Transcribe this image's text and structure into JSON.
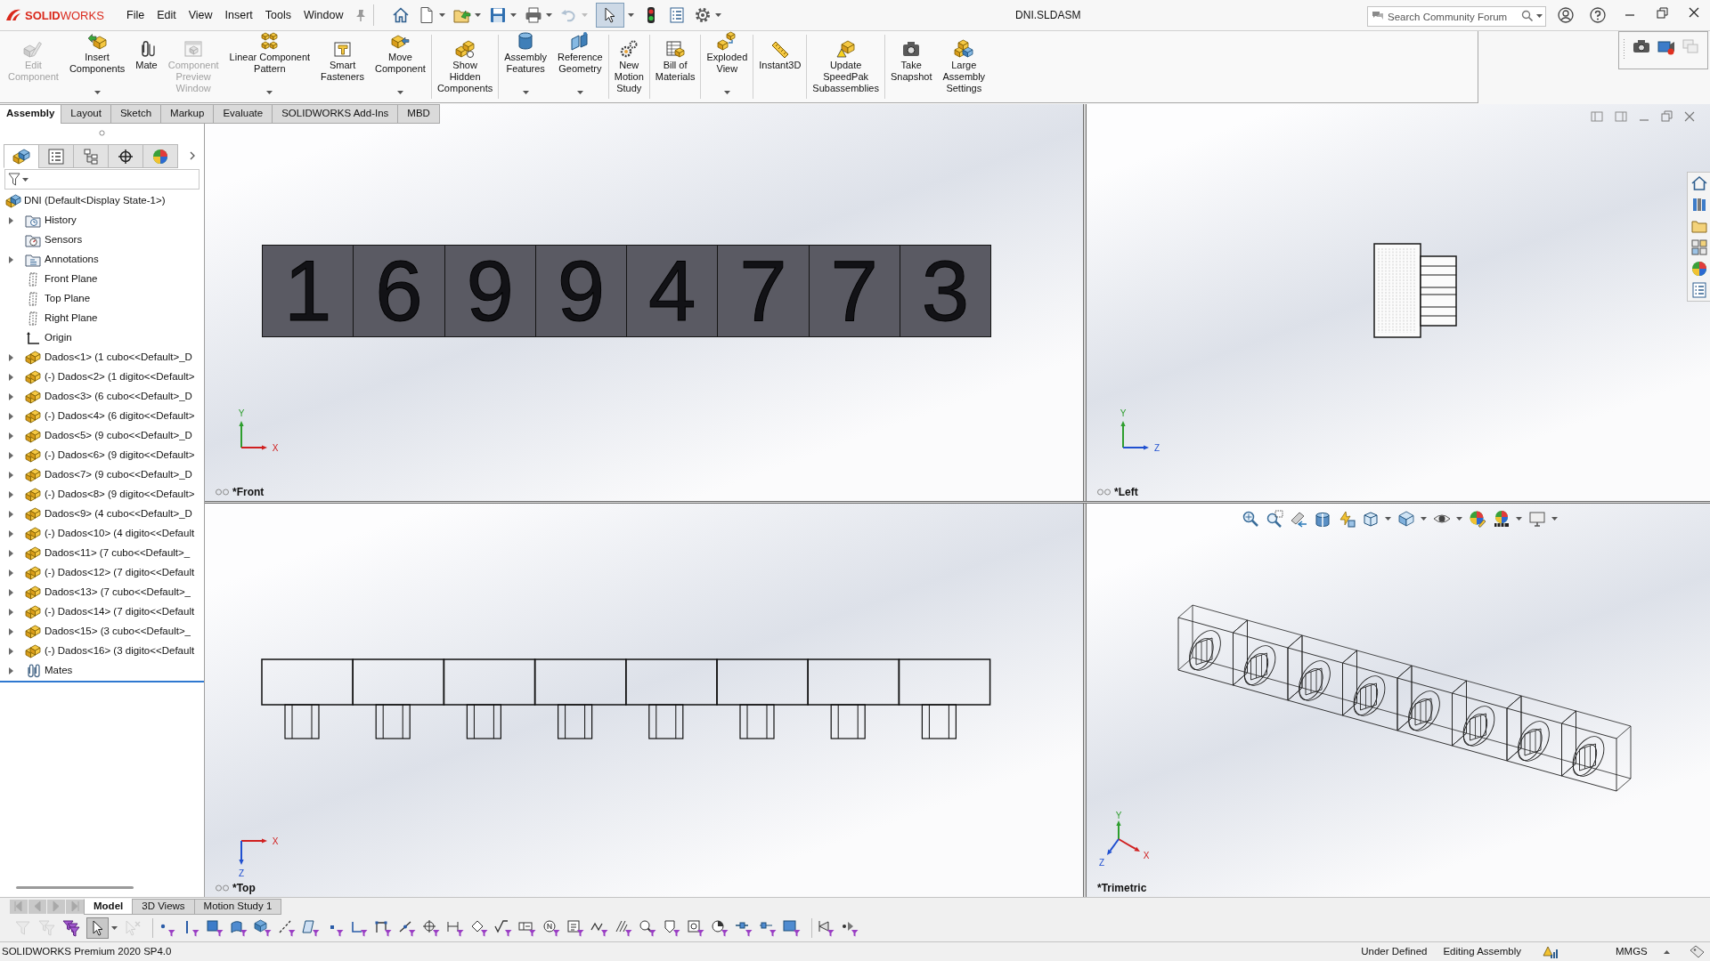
{
  "menubar": {
    "logo": "**SOLID**WORKS",
    "menus": [
      "File",
      "Edit",
      "View",
      "Insert",
      "Tools",
      "Window"
    ],
    "quick_access": [
      {
        "kind": "home",
        "dropdown": false,
        "disabled": false,
        "selected": false
      },
      {
        "kind": "new",
        "dropdown": true,
        "disabled": false,
        "selected": false
      },
      {
        "kind": "open",
        "dropdown": true,
        "disabled": false,
        "selected": false
      },
      {
        "kind": "save",
        "dropdown": true,
        "disabled": false,
        "selected": false
      },
      {
        "kind": "print",
        "dropdown": true,
        "disabled": false,
        "selected": false
      },
      {
        "kind": "undo",
        "dropdown": true,
        "disabled": true,
        "selected": false
      },
      {
        "kind": "select",
        "dropdown": true,
        "disabled": false,
        "selected": true
      },
      {
        "kind": "rebuild",
        "dropdown": false,
        "disabled": false,
        "selected": false
      },
      {
        "kind": "file-properties",
        "dropdown": false,
        "disabled": false,
        "selected": false
      },
      {
        "kind": "options",
        "dropdown": true,
        "disabled": false,
        "selected": false
      }
    ],
    "title": "DNI.SLDASM",
    "search": {
      "placeholder": "Search Community Forum"
    }
  },
  "ribbon": {
    "groups": [
      {
        "buttons": [
          {
            "label": "Edit\nComponent",
            "kind": "edit-component",
            "disabled": true,
            "dropdown": false
          },
          {
            "label": "Insert\nComponents",
            "kind": "insert-components",
            "disabled": false,
            "dropdown": true
          },
          {
            "label": "Mate",
            "kind": "mate",
            "disabled": false,
            "dropdown": false
          },
          {
            "label": "Component\nPreview\nWindow",
            "kind": "component-preview",
            "disabled": true,
            "dropdown": false
          },
          {
            "label": "Linear Component\nPattern",
            "kind": "linear-pattern",
            "disabled": false,
            "dropdown": true
          },
          {
            "label": "Smart\nFasteners",
            "kind": "smart-fasteners",
            "disabled": false,
            "dropdown": false
          },
          {
            "label": "Move\nComponent",
            "kind": "move-component",
            "disabled": false,
            "dropdown": true
          }
        ]
      },
      {
        "buttons": [
          {
            "label": "Show\nHidden\nComponents",
            "kind": "show-hidden",
            "disabled": false,
            "dropdown": false
          }
        ]
      },
      {
        "buttons": [
          {
            "label": "Assembly\nFeatures",
            "kind": "assembly-features",
            "disabled": false,
            "dropdown": true
          },
          {
            "label": "Reference\nGeometry",
            "kind": "reference-geometry",
            "disabled": false,
            "dropdown": true
          }
        ]
      },
      {
        "buttons": [
          {
            "label": "New\nMotion\nStudy",
            "kind": "motion-study",
            "disabled": false,
            "dropdown": false
          }
        ]
      },
      {
        "buttons": [
          {
            "label": "Bill of\nMaterials",
            "kind": "bill-of-materials",
            "disabled": false,
            "dropdown": false
          }
        ]
      },
      {
        "buttons": [
          {
            "label": "Exploded\nView",
            "kind": "exploded-view",
            "disabled": false,
            "dropdown": true
          }
        ]
      },
      {
        "buttons": [
          {
            "label": "Instant3D",
            "kind": "instant3d",
            "disabled": false,
            "dropdown": false
          }
        ]
      },
      {
        "buttons": [
          {
            "label": "Update\nSpeedPak\nSubassemblies",
            "kind": "speedpak",
            "disabled": false,
            "dropdown": false
          }
        ]
      },
      {
        "buttons": [
          {
            "label": "Take\nSnapshot",
            "kind": "snapshot",
            "disabled": false,
            "dropdown": false
          },
          {
            "label": "Large\nAssembly\nSettings",
            "kind": "large-assembly",
            "disabled": false,
            "dropdown": false
          }
        ]
      }
    ]
  },
  "ribbon_tabs": [
    {
      "label": "Assembly",
      "selected": true
    },
    {
      "label": "Layout",
      "selected": false
    },
    {
      "label": "Sketch",
      "selected": false
    },
    {
      "label": "Markup",
      "selected": false
    },
    {
      "label": "Evaluate",
      "selected": false
    },
    {
      "label": "SOLIDWORKS Add-Ins",
      "selected": false
    },
    {
      "label": "MBD",
      "selected": false
    }
  ],
  "feature_manager": {
    "tabs": [
      {
        "kind": "feature-tree",
        "selected": true
      },
      {
        "kind": "property-manager",
        "selected": false
      },
      {
        "kind": "configuration-manager",
        "selected": false
      },
      {
        "kind": "dimxpert",
        "selected": false
      },
      {
        "kind": "display-manager",
        "selected": false
      }
    ],
    "tree": {
      "label": "DNI (Default<Display State-1>)",
      "kind": "assembly",
      "children": [
        {
          "label": "History",
          "kind": "history",
          "expandable": true
        },
        {
          "label": "Sensors",
          "kind": "sensors",
          "expandable": false
        },
        {
          "label": "Annotations",
          "kind": "annotations",
          "expandable": true
        },
        {
          "label": "Front Plane",
          "kind": "plane",
          "expandable": false
        },
        {
          "label": "Top Plane",
          "kind": "plane",
          "expandable": false
        },
        {
          "label": "Right Plane",
          "kind": "plane",
          "expandable": false
        },
        {
          "label": "Origin",
          "kind": "origin",
          "expandable": false
        },
        {
          "label": "Dados<1> (1 cubo<<Default>_D",
          "kind": "part",
          "expandable": true
        },
        {
          "label": "(-) Dados<2> (1 digito<<Default>",
          "kind": "part",
          "expandable": true
        },
        {
          "label": "Dados<3> (6 cubo<<Default>_D",
          "kind": "part",
          "expandable": true
        },
        {
          "label": "(-) Dados<4> (6 digito<<Default>",
          "kind": "part",
          "expandable": true
        },
        {
          "label": "Dados<5> (9 cubo<<Default>_D",
          "kind": "part",
          "expandable": true
        },
        {
          "label": "(-) Dados<6> (9 digito<<Default>",
          "kind": "part",
          "expandable": true
        },
        {
          "label": "Dados<7> (9 cubo<<Default>_D",
          "kind": "part",
          "expandable": true
        },
        {
          "label": "(-) Dados<8> (9 digito<<Default>",
          "kind": "part",
          "expandable": true
        },
        {
          "label": "Dados<9> (4 cubo<<Default>_D",
          "kind": "part",
          "expandable": true
        },
        {
          "label": "(-) Dados<10> (4 digito<<Default",
          "kind": "part",
          "expandable": true
        },
        {
          "label": "Dados<11> (7 cubo<<Default>_",
          "kind": "part",
          "expandable": true
        },
        {
          "label": "(-) Dados<12> (7 digito<<Default",
          "kind": "part",
          "expandable": true
        },
        {
          "label": "Dados<13> (7 cubo<<Default>_",
          "kind": "part",
          "expandable": true
        },
        {
          "label": "(-) Dados<14> (7 digito<<Default",
          "kind": "part",
          "expandable": true
        },
        {
          "label": "Dados<15> (3 cubo<<Default>_",
          "kind": "part",
          "expandable": true
        },
        {
          "label": "(-) Dados<16> (3 digito<<Default",
          "kind": "part",
          "expandable": true
        },
        {
          "label": "Mates",
          "kind": "mates",
          "expandable": true
        }
      ]
    }
  },
  "viewports": [
    {
      "label": "*Front",
      "kind": "front",
      "active": false,
      "axes": [
        "Y",
        "X"
      ],
      "digits": [
        "1",
        "6",
        "9",
        "9",
        "4",
        "7",
        "7",
        "3"
      ]
    },
    {
      "label": "*Left",
      "kind": "left",
      "active": false,
      "axes": [
        "Y",
        "Z"
      ]
    },
    {
      "label": "*Top",
      "kind": "top",
      "active": false,
      "axes": [
        "X",
        "Z"
      ]
    },
    {
      "label": "*Trimetric",
      "kind": "trimetric",
      "active": true,
      "axes": [
        "Y",
        "X",
        "Z"
      ],
      "view_toolbar": [
        {
          "kind": "zoom-to-fit",
          "dropdown": false
        },
        {
          "kind": "zoom-area",
          "dropdown": false
        },
        {
          "kind": "previous-view",
          "dropdown": false
        },
        {
          "kind": "section-view",
          "dropdown": false
        },
        {
          "kind": "dynamic-annotation",
          "dropdown": false
        },
        {
          "kind": "view-orientation",
          "dropdown": true
        },
        {
          "kind": "display-style",
          "dropdown": true
        },
        {
          "kind": "hide-show",
          "dropdown": true
        },
        {
          "kind": "edit-appearance",
          "dropdown": false
        },
        {
          "kind": "apply-scene",
          "dropdown": true
        },
        {
          "kind": "view-settings",
          "dropdown": true
        }
      ]
    }
  ],
  "bottom_tabs": [
    {
      "label": "Model",
      "selected": true
    },
    {
      "label": "3D Views",
      "selected": false
    },
    {
      "label": "Motion Study 1",
      "selected": false
    }
  ],
  "selection_filter": {
    "groups": [
      [
        {
          "kind": "toggle-filter",
          "disabled": true,
          "selected": false
        },
        {
          "kind": "filter-toolbar",
          "disabled": true,
          "selected": false
        },
        {
          "kind": "clear-filters",
          "disabled": false,
          "selected": false
        },
        {
          "kind": "select",
          "disabled": false,
          "selected": true
        },
        {
          "kind": "select-other",
          "disabled": true,
          "selected": false
        }
      ],
      [
        {
          "kind": "vertex",
          "disabled": false,
          "selected": false
        },
        {
          "kind": "edge",
          "disabled": false,
          "selected": false
        },
        {
          "kind": "face",
          "disabled": false,
          "selected": false
        },
        {
          "kind": "surface",
          "disabled": false,
          "selected": false
        },
        {
          "kind": "solid",
          "disabled": false,
          "selected": false
        },
        {
          "kind": "axis",
          "disabled": false,
          "selected": false
        },
        {
          "kind": "plane",
          "disabled": false,
          "selected": false
        },
        {
          "kind": "sketch-point",
          "disabled": false,
          "selected": false
        },
        {
          "kind": "sketch-segment",
          "disabled": false,
          "selected": false
        },
        {
          "kind": "polyline",
          "disabled": false,
          "selected": false
        },
        {
          "kind": "centerline",
          "disabled": false,
          "selected": false
        },
        {
          "kind": "center-mark",
          "disabled": false,
          "selected": false
        },
        {
          "kind": "dimension",
          "disabled": false,
          "selected": false
        },
        {
          "kind": "datum-target",
          "disabled": false,
          "selected": false
        },
        {
          "kind": "surface-finish",
          "disabled": false,
          "selected": false
        },
        {
          "kind": "gtol",
          "disabled": false,
          "selected": false
        },
        {
          "kind": "balloon",
          "disabled": false,
          "selected": false
        },
        {
          "kind": "note",
          "disabled": false,
          "selected": false
        },
        {
          "kind": "weld",
          "disabled": false,
          "selected": false
        },
        {
          "kind": "hatch",
          "disabled": false,
          "selected": false
        },
        {
          "kind": "detail-circle",
          "disabled": false,
          "selected": false
        },
        {
          "kind": "cosmetic-thread",
          "disabled": false,
          "selected": false
        },
        {
          "kind": "block",
          "disabled": false,
          "selected": false
        },
        {
          "kind": "pie",
          "disabled": false,
          "selected": false
        },
        {
          "kind": "route-point",
          "disabled": false,
          "selected": false
        },
        {
          "kind": "connection-point",
          "disabled": false,
          "selected": false
        },
        {
          "kind": "mate-reference",
          "disabled": false,
          "selected": false
        }
      ],
      [
        {
          "kind": "spline-handle",
          "disabled": false,
          "selected": false
        },
        {
          "kind": "assembly-point",
          "disabled": false,
          "selected": false
        }
      ]
    ]
  },
  "status_bar": {
    "product": "SOLIDWORKS Premium 2020 SP4.0",
    "states": [
      "Under Defined",
      "Editing Assembly"
    ],
    "units": "MMGS"
  }
}
